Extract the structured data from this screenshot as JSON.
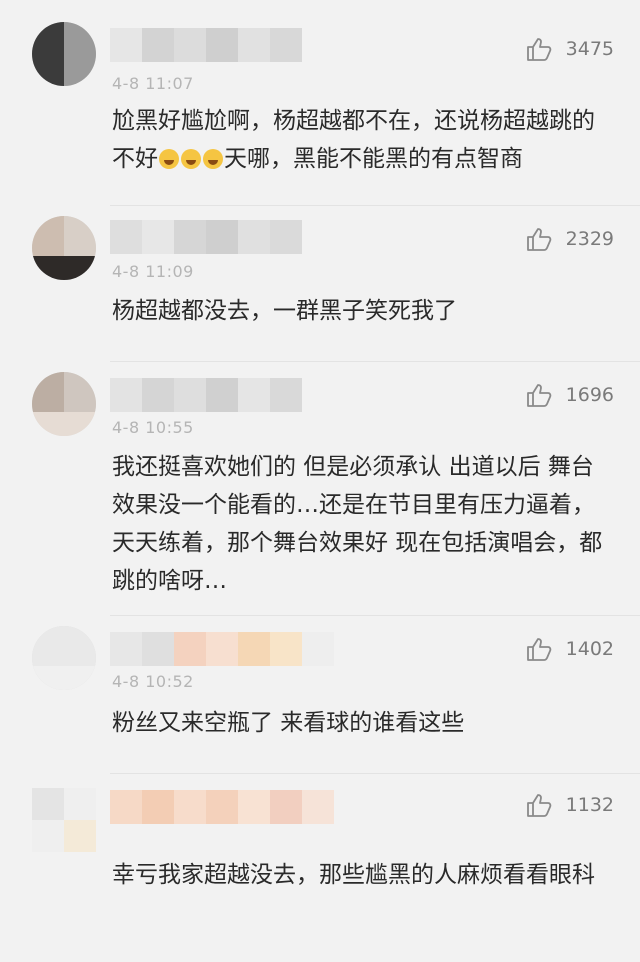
{
  "comments": [
    {
      "time": "4-8 11:07",
      "likes": "3475",
      "text_parts": [
        "尬黑好尴尬啊，杨超越都不在，还说杨超越跳的不好",
        "天哪，黑能不能黑的有点智商"
      ],
      "emoji_count": 3,
      "emoji_icon": "laughing-tears-emoji-icon"
    },
    {
      "time": "4-8 11:09",
      "likes": "2329",
      "text": "杨超越都没去，一群黑子笑死我了"
    },
    {
      "time": "4-8 10:55",
      "likes": "1696",
      "text": "我还挺喜欢她们的 但是必须承认 出道以后 舞台效果没一个能看的…还是在节目里有压力逼着，天天练着，那个舞台效果好 现在包括演唱会，都跳的啥呀…"
    },
    {
      "time": "4-8 10:52",
      "likes": "1402",
      "text": "粉丝又来空瓶了 来看球的谁看这些"
    },
    {
      "time": "",
      "likes": "1132",
      "text": "幸亏我家超越没去，那些尴黑的人麻烦看看眼科"
    }
  ],
  "icons": {
    "like": "thumbs-up-icon"
  },
  "colors": {
    "background": "#f2f2f2",
    "text": "#2a2a2a",
    "meta": "#b5b5b5",
    "like_count": "#7a7a7a"
  }
}
